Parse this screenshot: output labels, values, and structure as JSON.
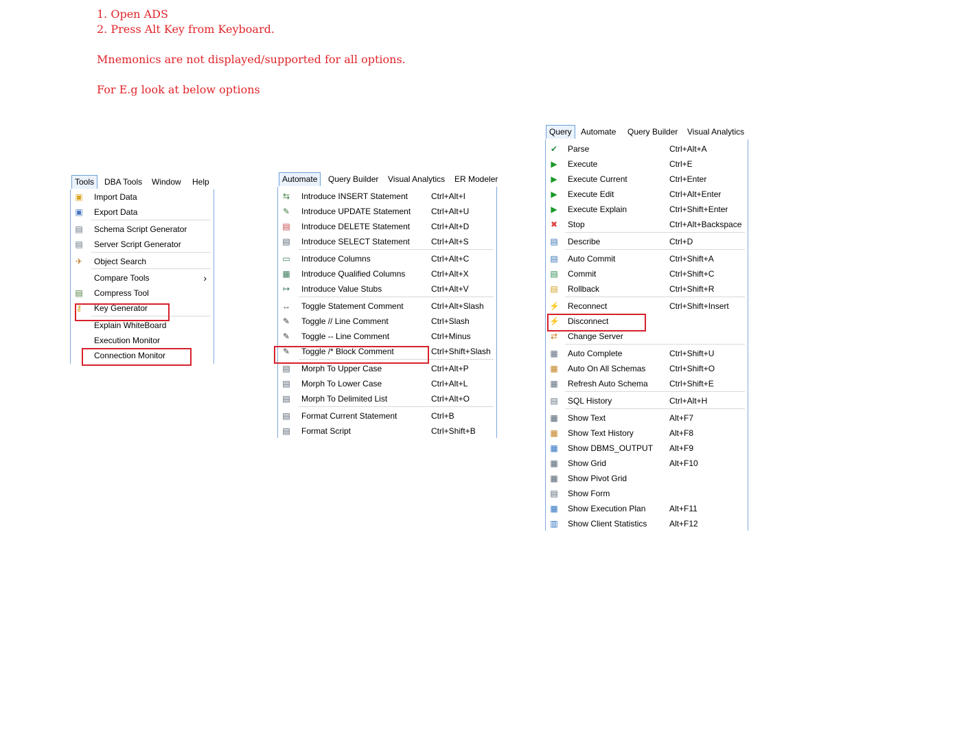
{
  "notes": [
    "1. Open ADS",
    "2. Press Alt Key from Keyboard.",
    "",
    "Mnemonics are not displayed/supported for all options.",
    "",
    "For E.g look at below options"
  ],
  "tools_menu": {
    "bar": [
      "Tools",
      "DBA Tools",
      "Window",
      "Help"
    ],
    "items": [
      {
        "label": "Import Data",
        "icon": "import-icon",
        "glyph": "▣",
        "color": "#d8a520"
      },
      {
        "label": "Export Data",
        "icon": "export-icon",
        "glyph": "▣",
        "color": "#4a78c0"
      },
      {
        "label": "Schema Script Generator",
        "icon": "schema-script-icon",
        "glyph": "▤",
        "color": "#607080"
      },
      {
        "label": "Server Script Generator",
        "icon": "server-script-icon",
        "glyph": "▤",
        "color": "#607080"
      },
      {
        "label": "Object Search",
        "icon": "object-search-icon",
        "glyph": "✈",
        "color": "#c08030"
      },
      {
        "label": "Compare Tools",
        "icon": "compare-icon",
        "glyph": "",
        "color": "#607080",
        "arrow": "›"
      },
      {
        "label": "Compress Tool",
        "icon": "compress-icon",
        "glyph": "▤",
        "color": "#508040"
      },
      {
        "label": "Key Generator",
        "icon": "key-icon",
        "glyph": "⚷",
        "color": "#d0a020"
      },
      {
        "label": "Explain WhiteBoard",
        "icon": "whiteboard-icon",
        "glyph": "",
        "color": "#607080"
      },
      {
        "label": "Execution Monitor",
        "icon": "exec-monitor-icon",
        "glyph": "",
        "color": "#607080"
      },
      {
        "label": "Connection Monitor",
        "icon": "conn-monitor-icon",
        "glyph": "",
        "color": "#607080"
      }
    ]
  },
  "automate_menu": {
    "bar": [
      "Automate",
      "Query Builder",
      "Visual Analytics",
      "ER Modeler"
    ],
    "items": [
      {
        "label": "Introduce INSERT Statement",
        "shortcut": "Ctrl+Alt+I",
        "icon": "insert-stmt-icon",
        "glyph": "⇆",
        "color": "#408040"
      },
      {
        "label": "Introduce UPDATE Statement",
        "shortcut": "Ctrl+Alt+U",
        "icon": "update-stmt-icon",
        "glyph": "✎",
        "color": "#408040"
      },
      {
        "label": "Introduce DELETE Statement",
        "shortcut": "Ctrl+Alt+D",
        "icon": "delete-stmt-icon",
        "glyph": "▤",
        "color": "#c04040"
      },
      {
        "label": "Introduce SELECT Statement",
        "shortcut": "Ctrl+Alt+S",
        "icon": "select-stmt-icon",
        "glyph": "▤",
        "color": "#506070"
      },
      {
        "label": "Introduce Columns",
        "shortcut": "Ctrl+Alt+C",
        "icon": "columns-icon",
        "glyph": "▭",
        "color": "#3a7a5a"
      },
      {
        "label": "Introduce Qualified Columns",
        "shortcut": "Ctrl+Alt+X",
        "icon": "qualified-columns-icon",
        "glyph": "▦",
        "color": "#3a7a5a"
      },
      {
        "label": "Introduce Value Stubs",
        "shortcut": "Ctrl+Alt+V",
        "icon": "value-stubs-icon",
        "glyph": "↦",
        "color": "#3a7a5a"
      },
      {
        "label": "Toggle Statement Comment",
        "shortcut": "Ctrl+Alt+Slash",
        "icon": "toggle-stmt-comment-icon",
        "glyph": "↔",
        "color": "#404040"
      },
      {
        "label": "Toggle // Line Comment",
        "shortcut": "Ctrl+Slash",
        "icon": "line-comment-icon",
        "glyph": "✎",
        "color": "#404040"
      },
      {
        "label": "Toggle -- Line Comment",
        "shortcut": "Ctrl+Minus",
        "icon": "dash-comment-icon",
        "glyph": "✎",
        "color": "#404040"
      },
      {
        "label": "Toggle /* Block Comment",
        "shortcut": "Ctrl+Shift+Slash",
        "icon": "block-comment-icon",
        "glyph": "✎",
        "color": "#404040"
      },
      {
        "label": "Morph To Upper Case",
        "shortcut": "Ctrl+Alt+P",
        "icon": "upper-case-icon",
        "glyph": "▤",
        "color": "#506070"
      },
      {
        "label": "Morph To Lower Case",
        "shortcut": "Ctrl+Alt+L",
        "icon": "lower-case-icon",
        "glyph": "▤",
        "color": "#506070"
      },
      {
        "label": "Morph To Delimited List",
        "shortcut": "Ctrl+Alt+O",
        "icon": "delimited-list-icon",
        "glyph": "▤",
        "color": "#506070"
      },
      {
        "label": "Format Current Statement",
        "shortcut": "Ctrl+B",
        "icon": "format-stmt-icon",
        "glyph": "▤",
        "color": "#506070"
      },
      {
        "label": "Format Script",
        "shortcut": "Ctrl+Shift+B",
        "icon": "format-script-icon",
        "glyph": "▤",
        "color": "#506070"
      }
    ]
  },
  "query_menu": {
    "bar": [
      "Query",
      "Automate",
      "Query Builder",
      "Visual Analytics"
    ],
    "items": [
      {
        "label": "Parse",
        "shortcut": "Ctrl+Alt+A",
        "icon": "parse-icon",
        "glyph": "✔",
        "color": "#2a8a4a"
      },
      {
        "label": "Execute",
        "shortcut": "Ctrl+E",
        "icon": "execute-icon",
        "glyph": "▶",
        "color": "#1a9a2a"
      },
      {
        "label": "Execute Current",
        "shortcut": "Ctrl+Enter",
        "icon": "execute-current-icon",
        "glyph": "▶",
        "color": "#1a9a2a"
      },
      {
        "label": "Execute Edit",
        "shortcut": "Ctrl+Alt+Enter",
        "icon": "execute-edit-icon",
        "glyph": "▶",
        "color": "#1a9a2a"
      },
      {
        "label": "Execute Explain",
        "shortcut": "Ctrl+Shift+Enter",
        "icon": "execute-explain-icon",
        "glyph": "▶",
        "color": "#1a9a2a"
      },
      {
        "label": "Stop",
        "shortcut": "Ctrl+Alt+Backspace",
        "icon": "stop-icon",
        "glyph": "✖",
        "color": "#e04040"
      },
      {
        "label": "Describe",
        "shortcut": "Ctrl+D",
        "icon": "describe-icon",
        "glyph": "▤",
        "color": "#3070b0"
      },
      {
        "label": "Auto Commit",
        "shortcut": "Ctrl+Shift+A",
        "icon": "auto-commit-icon",
        "glyph": "▤",
        "color": "#3070b0"
      },
      {
        "label": "Commit",
        "shortcut": "Ctrl+Shift+C",
        "icon": "commit-icon",
        "glyph": "▤",
        "color": "#2a8a4a"
      },
      {
        "label": "Rollback",
        "shortcut": "Ctrl+Shift+R",
        "icon": "rollback-icon",
        "glyph": "▤",
        "color": "#d0a020"
      },
      {
        "label": "Reconnect",
        "shortcut": "Ctrl+Shift+Insert",
        "icon": "reconnect-icon",
        "glyph": "⚡",
        "color": "#d08020"
      },
      {
        "label": "Disconnect",
        "shortcut": "",
        "icon": "disconnect-icon",
        "glyph": "⚡",
        "color": "#d04020"
      },
      {
        "label": "Change Server",
        "shortcut": "",
        "icon": "change-server-icon",
        "glyph": "⇄",
        "color": "#d08020"
      },
      {
        "label": "Auto Complete",
        "shortcut": "Ctrl+Shift+U",
        "icon": "auto-complete-icon",
        "glyph": "▦",
        "color": "#607080"
      },
      {
        "label": "Auto On All Schemas",
        "shortcut": "Ctrl+Shift+O",
        "icon": "auto-all-schemas-icon",
        "glyph": "▦",
        "color": "#c08020"
      },
      {
        "label": "Refresh Auto Schema",
        "shortcut": "Ctrl+Shift+E",
        "icon": "refresh-schema-icon",
        "glyph": "▦",
        "color": "#607080"
      },
      {
        "label": "SQL History",
        "shortcut": "Ctrl+Alt+H",
        "icon": "sql-history-icon",
        "glyph": "▤",
        "color": "#607080"
      },
      {
        "label": "Show Text",
        "shortcut": "Alt+F7",
        "icon": "show-text-icon",
        "glyph": "▦",
        "color": "#506070"
      },
      {
        "label": "Show Text History",
        "shortcut": "Alt+F8",
        "icon": "show-text-history-icon",
        "glyph": "▦",
        "color": "#c08020"
      },
      {
        "label": "Show DBMS_OUTPUT",
        "shortcut": "Alt+F9",
        "icon": "show-dbms-output-icon",
        "glyph": "▦",
        "color": "#2a70c0"
      },
      {
        "label": "Show Grid",
        "shortcut": "Alt+F10",
        "icon": "show-grid-icon",
        "glyph": "▦",
        "color": "#506070"
      },
      {
        "label": "Show Pivot Grid",
        "shortcut": "",
        "icon": "show-pivot-grid-icon",
        "glyph": "▦",
        "color": "#506070"
      },
      {
        "label": "Show Form",
        "shortcut": "",
        "icon": "show-form-icon",
        "glyph": "▤",
        "color": "#506070"
      },
      {
        "label": "Show Execution Plan",
        "shortcut": "Alt+F11",
        "icon": "show-exec-plan-icon",
        "glyph": "▦",
        "color": "#2a70c0"
      },
      {
        "label": "Show Client Statistics",
        "shortcut": "Alt+F12",
        "icon": "show-client-stats-icon",
        "glyph": "▥",
        "color": "#2a70c0"
      }
    ]
  },
  "colors": {
    "annotation": "#e0242a",
    "highlight_box": "#d6202a",
    "menu_border": "#7ea7d8"
  }
}
